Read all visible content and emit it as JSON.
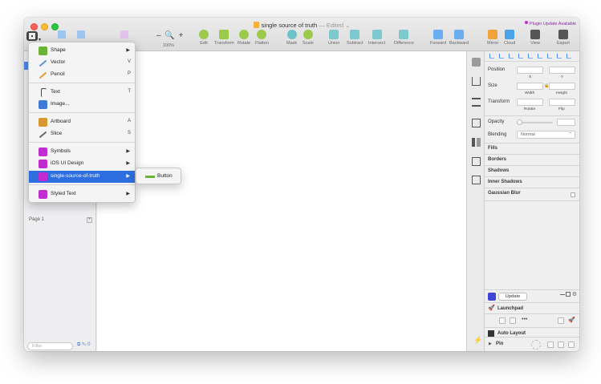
{
  "window": {
    "title": "single source of truth",
    "edited_label": "— Edited ⌄",
    "plugin_update": "Plugin Update Available"
  },
  "toolbar": {
    "zoom_value": "– 🔍 +",
    "zoom_label": "100%",
    "left_tools": [
      {
        "label": "Edit",
        "color": "#9bc94a"
      },
      {
        "label": "Transform",
        "color": "#9bc94a"
      },
      {
        "label": "Rotate",
        "color": "#9bc94a"
      },
      {
        "label": "Flatten",
        "color": "#9bc94a"
      },
      {
        "label": "Mask",
        "color": "#6cc3c9"
      },
      {
        "label": "Scale",
        "color": "#9bc94a"
      },
      {
        "label": "Union",
        "color": "#7ec9d0"
      },
      {
        "label": "Subtract",
        "color": "#7ec9d0"
      },
      {
        "label": "Intersect",
        "color": "#7ec9d0"
      },
      {
        "label": "Difference",
        "color": "#7ec9d0"
      },
      {
        "label": "Forward",
        "color": "#6aaef0"
      },
      {
        "label": "Backward",
        "color": "#6aaef0"
      },
      {
        "label": "Mirror",
        "color": "#f0a33a"
      },
      {
        "label": "Cloud",
        "color": "#4aa3e8"
      },
      {
        "label": "View",
        "color": "#555555"
      },
      {
        "label": "Export",
        "color": "#555555"
      }
    ]
  },
  "insert_menu": {
    "items": [
      {
        "label": "Shape",
        "key": "",
        "arrow": "▶",
        "icon_color": "#6bb334"
      },
      {
        "label": "Vector",
        "key": "V",
        "arrow": "",
        "icon_color": "#5b8fd8"
      },
      {
        "label": "Pencil",
        "key": "P",
        "arrow": "",
        "icon_color": "#e0a030"
      },
      {
        "label": "Text",
        "key": "T",
        "arrow": "",
        "icon_color": "#444444"
      },
      {
        "label": "Image...",
        "key": "",
        "arrow": "",
        "icon_color": "#3f7ad6"
      },
      {
        "label": "Artboard",
        "key": "A",
        "arrow": "",
        "icon_color": "#d9982f"
      },
      {
        "label": "Slice",
        "key": "S",
        "arrow": "",
        "icon_color": "#666666"
      },
      {
        "label": "Symbols",
        "key": "",
        "arrow": "▶",
        "icon_color": "#c02cd0"
      },
      {
        "label": "iOS UI Design",
        "key": "",
        "arrow": "▶",
        "icon_color": "#c02cd0"
      },
      {
        "label": "single-source-of-truth",
        "key": "",
        "arrow": "▶",
        "icon_color": "#c02cd0"
      },
      {
        "label": "Styled Text",
        "key": "",
        "arrow": "▶",
        "icon_color": "#c02cd0"
      }
    ],
    "submenu_item": "Button"
  },
  "sidebar": {
    "page_label": "Page 1",
    "filter_placeholder": "Filter",
    "filter_icons": "⧉ ✎ 0"
  },
  "inspector": {
    "position_label": "Position",
    "x_label": "X",
    "y_label": "Y",
    "size_label": "Size",
    "width_label": "Width",
    "height_label": "Height",
    "transform_label": "Transform",
    "rotate_label": "Rotate",
    "flip_label": "Flip",
    "opacity_label": "Opacity",
    "blending_label": "Blending",
    "blending_value": "Normal",
    "sections": [
      "Fills",
      "Borders",
      "Shadows",
      "Inner Shadows",
      "Gaussian Blur"
    ],
    "plugin_update_button": "Update",
    "launchpad_label": "Launchpad",
    "autolayout_label": "Auto Layout",
    "pin_label": "Pin"
  }
}
